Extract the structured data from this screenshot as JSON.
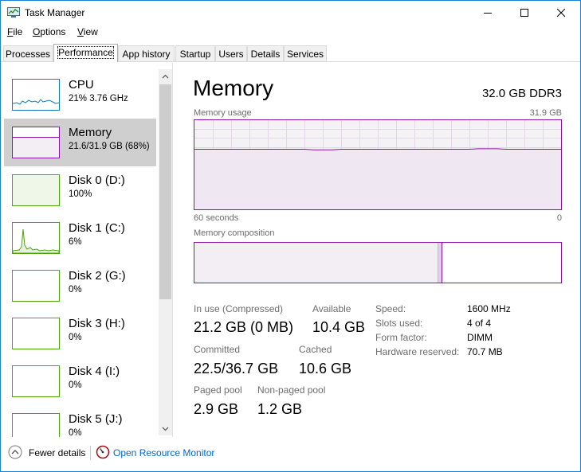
{
  "window": {
    "title": "Task Manager",
    "accent_color": "#1883d7"
  },
  "menu": [
    {
      "label": "File",
      "accel": "F"
    },
    {
      "label": "Options",
      "accel": "O"
    },
    {
      "label": "View",
      "accel": "V"
    }
  ],
  "tabs": [
    {
      "label": "Processes",
      "active": false
    },
    {
      "label": "Performance",
      "active": true
    },
    {
      "label": "App history",
      "active": false
    },
    {
      "label": "Startup",
      "active": false
    },
    {
      "label": "Users",
      "active": false
    },
    {
      "label": "Details",
      "active": false
    },
    {
      "label": "Services",
      "active": false
    }
  ],
  "sidebar": {
    "items": [
      {
        "name": "CPU",
        "sub": "21%  3.76 GHz",
        "color": "#117dbb",
        "selected": false
      },
      {
        "name": "Memory",
        "sub": "21.6/31.9 GB (68%)",
        "color": "#8b12ae",
        "selected": true
      },
      {
        "name": "Disk 0 (D:)",
        "sub": "100%",
        "color": "#4da60c",
        "selected": false
      },
      {
        "name": "Disk 1 (C:)",
        "sub": "6%",
        "color": "#4da60c",
        "selected": false
      },
      {
        "name": "Disk 2 (G:)",
        "sub": "0%",
        "color": "#4da60c",
        "selected": false
      },
      {
        "name": "Disk 3 (H:)",
        "sub": "0%",
        "color": "#4da60c",
        "selected": false
      },
      {
        "name": "Disk 4 (I:)",
        "sub": "0%",
        "color": "#4da60c",
        "selected": false
      },
      {
        "name": "Disk 5 (J:)",
        "sub": "0%",
        "color": "#4da60c",
        "selected": false
      }
    ]
  },
  "main": {
    "title": "Memory",
    "spec": "32.0 GB DDR3",
    "usage_label": "Memory usage",
    "usage_max": "31.9 GB",
    "time_left": "60 seconds",
    "time_right": "0",
    "composition_label": "Memory composition",
    "usage_fraction": 0.68,
    "stats": {
      "in_use_label": "In use (Compressed)",
      "in_use_value": "21.2 GB (0 MB)",
      "available_label": "Available",
      "available_value": "10.4 GB",
      "committed_label": "Committed",
      "committed_value": "22.5/36.7 GB",
      "cached_label": "Cached",
      "cached_value": "10.6 GB",
      "paged_label": "Paged pool",
      "paged_value": "2.9 GB",
      "nonpaged_label": "Non-paged pool",
      "nonpaged_value": "1.2 GB"
    },
    "details": [
      {
        "label": "Speed:",
        "value": "1600 MHz"
      },
      {
        "label": "Slots used:",
        "value": "4 of 4"
      },
      {
        "label": "Form factor:",
        "value": "DIMM"
      },
      {
        "label": "Hardware reserved:",
        "value": "70.7 MB"
      }
    ]
  },
  "footer": {
    "fewer_details": "Fewer details",
    "open_resource_monitor": "Open Resource Monitor"
  }
}
